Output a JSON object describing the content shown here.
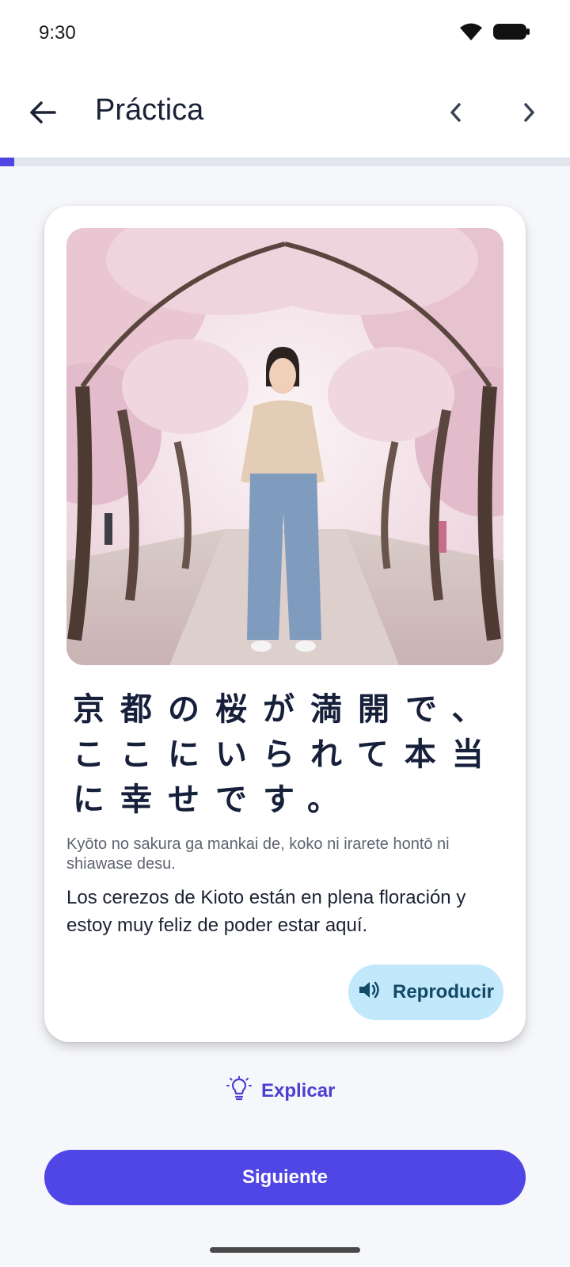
{
  "status_bar": {
    "time": "9:30",
    "wifi_icon": "wifi-icon",
    "battery_icon": "battery-icon"
  },
  "app_bar": {
    "title": "Práctica",
    "back_icon": "arrow-left-icon",
    "prev_icon": "chevron-left-icon",
    "next_icon": "chevron-right-icon"
  },
  "progress": {
    "fraction": 0.025,
    "color": "#4f46e5"
  },
  "card": {
    "image_description": "woman-under-cherry-blossoms",
    "japanese": "京都の桜が満開で、ここにいられて本当に幸せです。",
    "romaji": "Kyōto no sakura ga mankai de, koko ni irarete hontō ni shiawase desu.",
    "translation": "Los cerezos de Kioto están en plena floración y estoy muy feliz de poder estar aquí.",
    "play_label": "Reproducir",
    "play_icon": "speaker-icon"
  },
  "explain": {
    "label": "Explicar",
    "icon": "lightbulb-icon"
  },
  "next_button": {
    "label": "Siguiente"
  },
  "colors": {
    "accent": "#4f46e5",
    "play_bg": "#c2e8fb",
    "background": "#f6f7fb"
  }
}
